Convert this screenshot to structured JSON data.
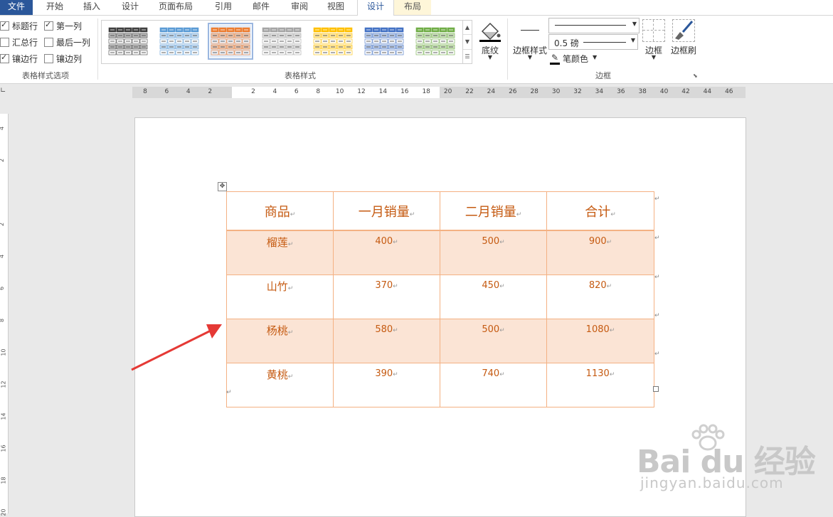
{
  "ribbon_tabs": {
    "file": "文件",
    "home": "开始",
    "insert": "插入",
    "design": "设计",
    "layout_page": "页面布局",
    "references": "引用",
    "mailings": "邮件",
    "review": "审阅",
    "view": "视图",
    "table_design": "设计",
    "table_layout": "布局"
  },
  "style_options": {
    "header_row": "标题行",
    "first_column": "第一列",
    "total_row": "汇总行",
    "last_column": "最后一列",
    "banded_rows": "镶边行",
    "banded_columns": "镶边列",
    "group_label": "表格样式选项"
  },
  "table_styles": {
    "group_label": "表格样式",
    "shading_label": "底纹",
    "swatch_colors": [
      "#404040",
      "#5b9bd5",
      "#ed7d31",
      "#a5a5a5",
      "#ffc000",
      "#4472c4",
      "#70ad47"
    ]
  },
  "borders": {
    "border_style_label": "边框样式",
    "pen_weight": "0.5 磅",
    "pen_color_label": "笔颜色",
    "borders_label": "边框",
    "border_painter_label": "边框刷",
    "group_label": "边框"
  },
  "ruler": {
    "numbers": [
      "8",
      "6",
      "4",
      "2",
      "",
      "2",
      "4",
      "6",
      "8",
      "10",
      "12",
      "14",
      "16",
      "18",
      "20",
      "22",
      "24",
      "26",
      "28",
      "30",
      "32",
      "34",
      "36",
      "38",
      "40",
      "42",
      "44",
      "46"
    ],
    "vertical_numbers": [
      "4",
      "2",
      "",
      "2",
      "4",
      "6",
      "8",
      "10",
      "12",
      "14",
      "16",
      "18",
      "20"
    ]
  },
  "table": {
    "headers": [
      "商品",
      "一月销量",
      "二月销量",
      "合计"
    ],
    "rows": [
      [
        "榴莲",
        "400",
        "500",
        "900"
      ],
      [
        "山竹",
        "370",
        "450",
        "820"
      ],
      [
        "杨桃",
        "580",
        "500",
        "1080"
      ],
      [
        "黄桃",
        "390",
        "740",
        "1130"
      ]
    ],
    "paragraph_mark": "↵"
  },
  "watermark": {
    "logo": "Bai du 经验",
    "url": "jingyan.baidu.com"
  },
  "colors": {
    "accent_text": "#c55a11",
    "band_fill": "#fbe4d5",
    "table_border": "#f4b183",
    "arrow": "#e53935",
    "file_tab": "#2b579a"
  }
}
